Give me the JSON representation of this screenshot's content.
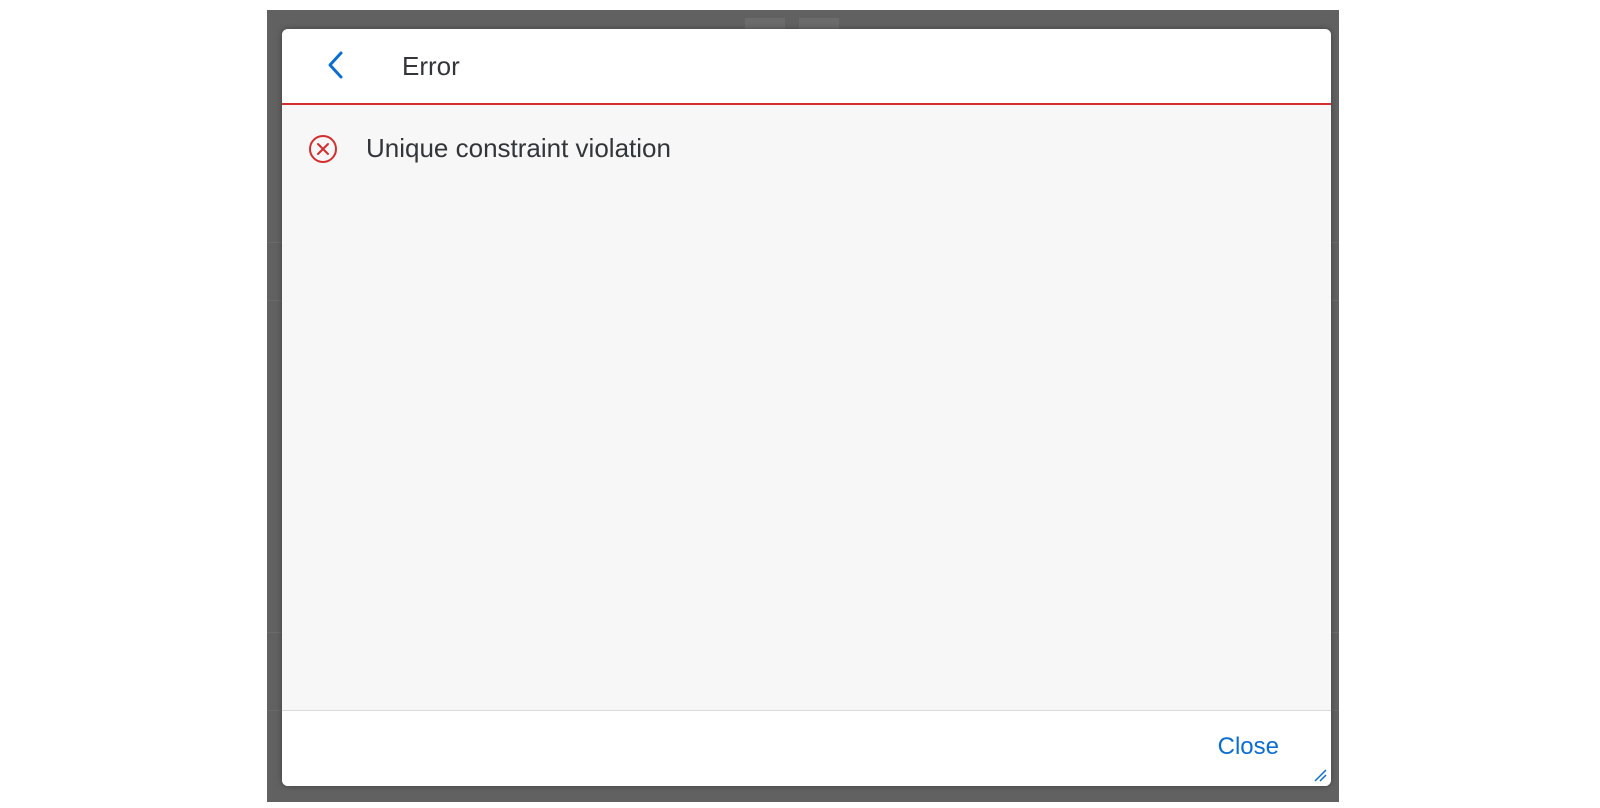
{
  "dialog": {
    "title": "Error",
    "message": "Unique constraint violation",
    "close_label": "Close"
  },
  "icons": {
    "back": "chevron-left-icon",
    "error": "error-circle-x-icon",
    "resize": "resize-handle-icon"
  },
  "colors": {
    "accent": "#0a6ed1",
    "error": "#d32f2f",
    "backdrop": "#616161",
    "text": "#32363a"
  }
}
